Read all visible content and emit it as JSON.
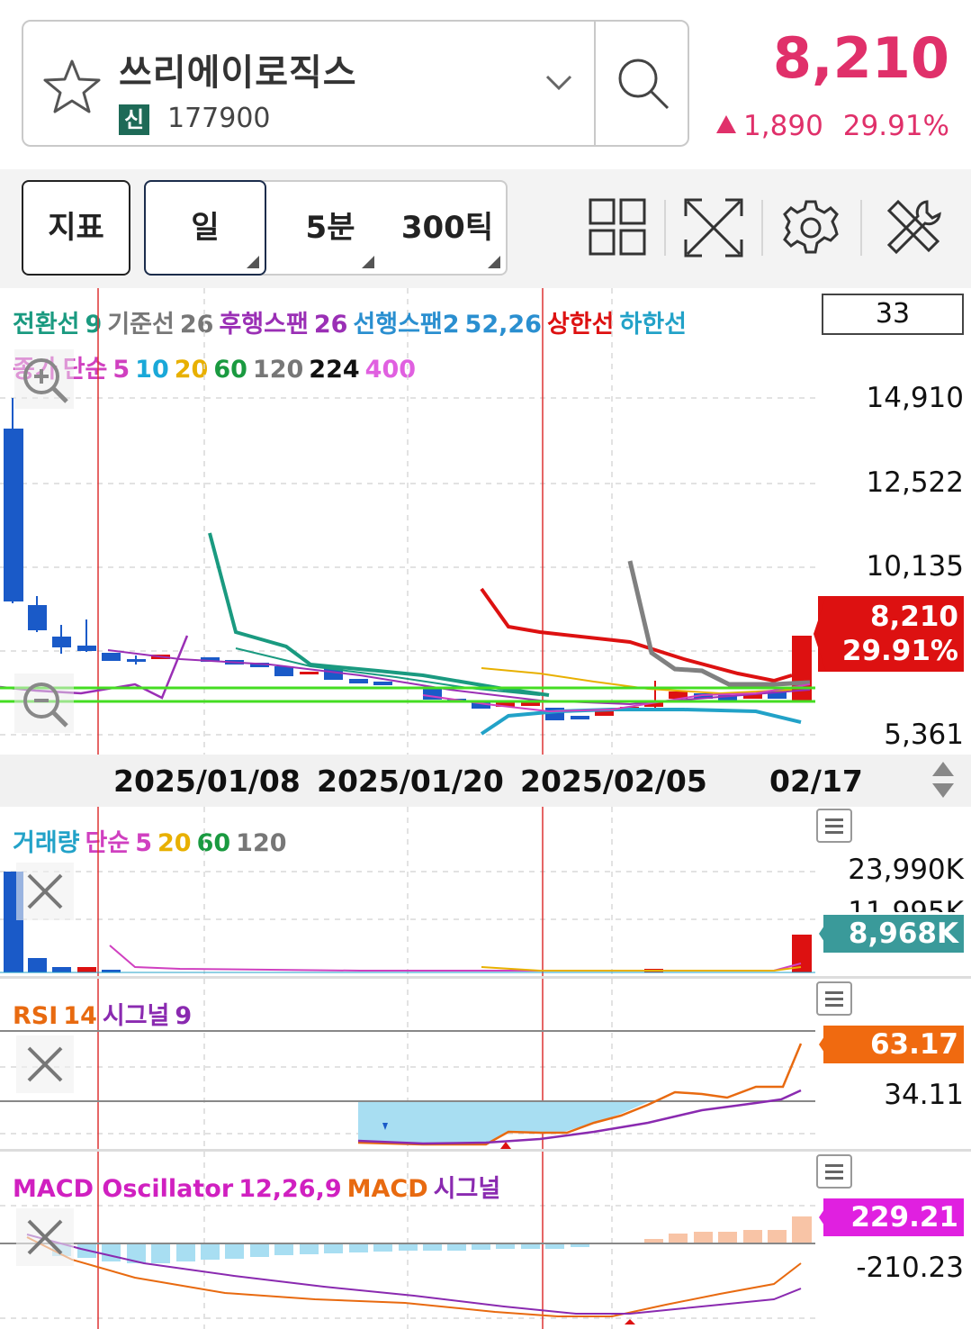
{
  "header": {
    "stock_name": "쓰리에이로직스",
    "market_badge": "신",
    "stock_code": "177900",
    "price": "8,210",
    "change": "1,890",
    "change_pct": "29.91%",
    "up_color": "#e0306a"
  },
  "toolbar": {
    "indicator_label": "지표",
    "periods": [
      "일",
      "5분",
      "300틱"
    ],
    "icons": [
      "layout-grid-icon",
      "fullscreen-icon",
      "settings-gear-icon",
      "tools-icon"
    ]
  },
  "main_chart": {
    "legend_line1": [
      {
        "text": "전환선",
        "color": "#1a9a80"
      },
      {
        "text": "9",
        "color": "#1a9a80"
      },
      {
        "text": "기준선",
        "color": "#777777"
      },
      {
        "text": "26",
        "color": "#777777"
      },
      {
        "text": "후행스팬",
        "color": "#9a2fb5"
      },
      {
        "text": "26",
        "color": "#9a2fb5"
      },
      {
        "text": "선행스팬2",
        "color": "#2a8fd0"
      },
      {
        "text": "52,26",
        "color": "#2a8fd0"
      },
      {
        "text": "상한선",
        "color": "#dd1111"
      },
      {
        "text": "하한선",
        "color": "#22a2c8"
      }
    ],
    "legend_line2": [
      {
        "text": "종가",
        "color": "#d040c0"
      },
      {
        "text": "단순",
        "color": "#d040c0"
      },
      {
        "text": "5",
        "color": "#d040c0"
      },
      {
        "text": "10",
        "color": "#1aa8d8"
      },
      {
        "text": "20",
        "color": "#e8b000"
      },
      {
        "text": "60",
        "color": "#1a9a40"
      },
      {
        "text": "120",
        "color": "#777777"
      },
      {
        "text": "224",
        "color": "#111111"
      },
      {
        "text": "400",
        "color": "#e060e0"
      }
    ],
    "ichimoku_value": "33",
    "y_labels": [
      "14,910",
      "12,522",
      "10,135",
      "5,361"
    ],
    "price_tag_value": "8,210",
    "price_tag_pct": "29.91%",
    "dates": [
      "2025/01/08",
      "2025/01/20",
      "2025/02/05",
      "02/17"
    ]
  },
  "volume": {
    "legend": [
      {
        "text": "거래량",
        "color": "#22a2c8"
      },
      {
        "text": "단순",
        "color": "#d040c0"
      },
      {
        "text": "5",
        "color": "#d040c0"
      },
      {
        "text": "20",
        "color": "#e8b000"
      },
      {
        "text": "60",
        "color": "#1a9a40"
      },
      {
        "text": "120",
        "color": "#777777"
      }
    ],
    "y_label": "23,990K",
    "y_label_partial": "11,995K",
    "current_tag": "8,968K"
  },
  "rsi": {
    "legend": [
      {
        "text": "RSI",
        "color": "#e86a10"
      },
      {
        "text": "14",
        "color": "#e86a10"
      },
      {
        "text": "시그널",
        "color": "#8a2ab0"
      },
      {
        "text": "9",
        "color": "#8a2ab0"
      }
    ],
    "current_tag": "63.17",
    "signal_value": "34.11"
  },
  "macd": {
    "legend": [
      {
        "text": "MACD Oscillator",
        "color": "#d020c0"
      },
      {
        "text": "12,26,9",
        "color": "#d020c0"
      },
      {
        "text": "MACD",
        "color": "#e86a10"
      },
      {
        "text": "시그널",
        "color": "#8a2ab0"
      }
    ],
    "current_tag": "229.21",
    "signal_value": "-210.23"
  }
}
